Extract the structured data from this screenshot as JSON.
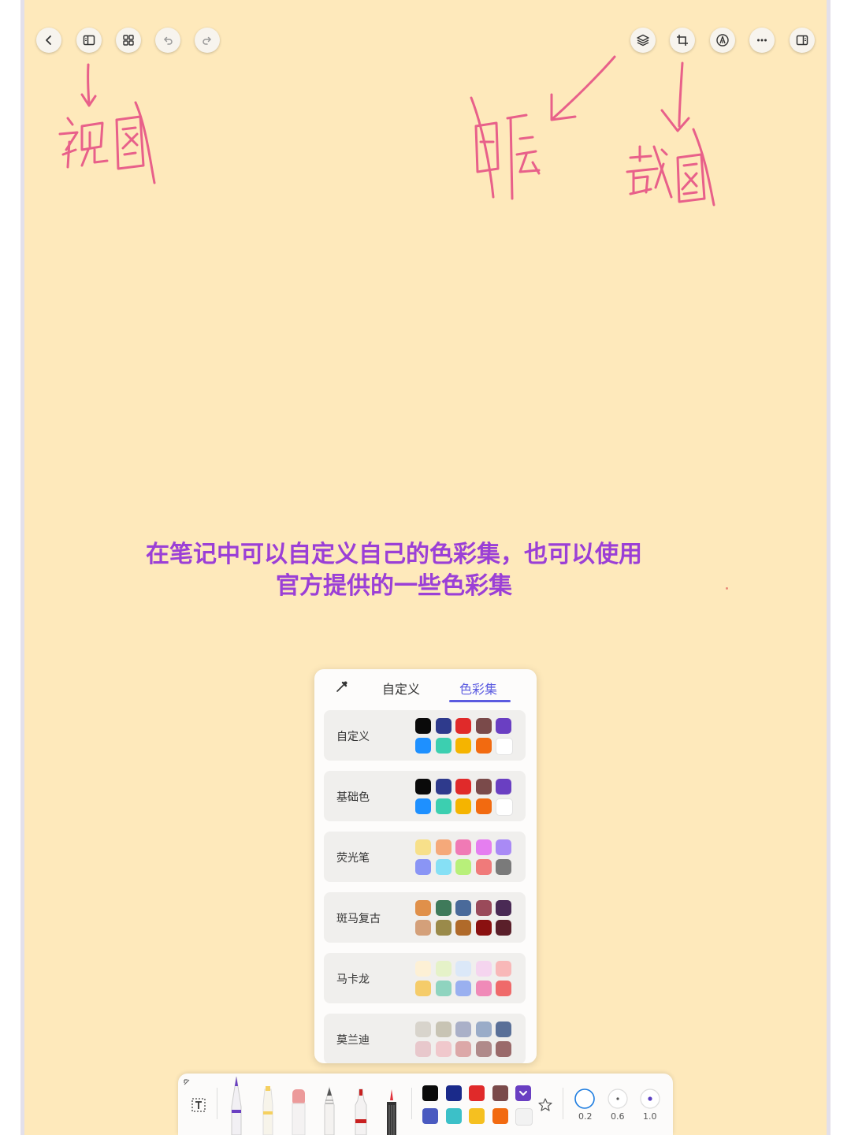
{
  "caption": {
    "line1": "在笔记中可以自定义自己的色彩集，也可以使用",
    "line2": "官方提供的一些色彩集"
  },
  "toolbar_left": [
    {
      "icon": "back-icon"
    },
    {
      "icon": "view-icon"
    },
    {
      "icon": "grid-icon"
    },
    {
      "icon": "undo-icon"
    },
    {
      "icon": "redo-icon"
    }
  ],
  "toolbar_right": [
    {
      "icon": "layers-icon"
    },
    {
      "icon": "crop-icon"
    },
    {
      "icon": "pen-mode-icon"
    },
    {
      "icon": "more-icon"
    },
    {
      "icon": "sidebar-icon"
    }
  ],
  "palette_panel": {
    "tabs": [
      "自定义",
      "色彩集"
    ],
    "active_tab": "色彩集",
    "sets": [
      {
        "name": "自定义",
        "colors": [
          "#0a0a0a",
          "#2e3a8c",
          "#e02a2a",
          "#7a4a4a",
          "#6a3fc2",
          "#1e90ff",
          "#3ccfb0",
          "#f5b400",
          "#f26a10",
          "#ffffff"
        ]
      },
      {
        "name": "基础色",
        "colors": [
          "#0a0a0a",
          "#2e3a8c",
          "#e02a2a",
          "#7a4a4a",
          "#6a3fc2",
          "#1e90ff",
          "#3ccfb0",
          "#f5b400",
          "#f26a10",
          "#ffffff"
        ]
      },
      {
        "name": "荧光笔",
        "colors": [
          "#f7e08a",
          "#f5a97a",
          "#f07ab5",
          "#e57ef0",
          "#a98af5",
          "#8a95f5",
          "#86e0f5",
          "#b8f07a",
          "#f07a7a",
          "#7a7a7a"
        ]
      },
      {
        "name": "斑马复古",
        "colors": [
          "#e0904a",
          "#3f7a5a",
          "#4a6a9a",
          "#9a4a5a",
          "#4a2a55",
          "#d4a07a",
          "#9a8a4a",
          "#b06a2a",
          "#8a1010",
          "#5a1f2a"
        ]
      },
      {
        "name": "马卡龙",
        "colors": [
          "#fdf0d5",
          "#e5f2c8",
          "#dbe8f8",
          "#f5d5ef",
          "#f8b8b8",
          "#f5cc6a",
          "#8fd4bf",
          "#9ab0f0",
          "#f08ab8",
          "#ef6a6a"
        ]
      },
      {
        "name": "莫兰迪",
        "colors": [
          "#d8d4cc",
          "#c8c4b4",
          "#aab0c8",
          "#9aacc8",
          "#5a7098",
          "#e8c8cc",
          "#f0c8cc",
          "#dca8a8",
          "#b08a8a",
          "#9a6a6a"
        ]
      }
    ]
  },
  "bottom_toolbar": {
    "tools": [
      "text-tool",
      "fountain-pen",
      "highlighter",
      "eraser",
      "pencil",
      "marker",
      "brush"
    ],
    "colors": [
      "#0a0a0a",
      "#1a2a8a",
      "#e02a2a",
      "#7a4a4a",
      "#6a3fc2",
      "#4a5ac0",
      "#3cc0c8",
      "#f5c020",
      "#f26a10",
      "#f2f2f2"
    ],
    "sizes": [
      "0.2",
      "0.6",
      "1.0"
    ]
  },
  "annotations": {
    "view": "视图",
    "layers": "图层",
    "screenshot": "截图"
  }
}
